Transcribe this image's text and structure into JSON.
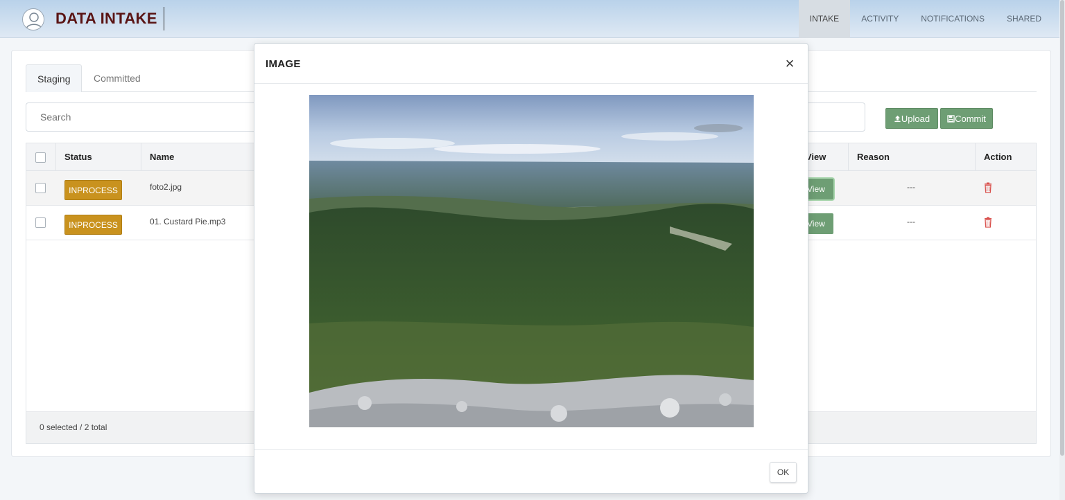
{
  "header": {
    "title": "DATA INTAKE",
    "nav": [
      "INTAKE",
      "ACTIVITY",
      "NOTIFICATIONS",
      "SHARED"
    ],
    "active_nav": "INTAKE"
  },
  "tabs": [
    "Staging",
    "Committed"
  ],
  "search": {
    "placeholder": "Search"
  },
  "toolbar": {
    "upload_label": "Upload",
    "commit_label": "Commit"
  },
  "table": {
    "headers": {
      "status": "Status",
      "name": "Name",
      "view": "View",
      "reason": "Reason",
      "action": "Action"
    },
    "rows": [
      {
        "status": "INPROCESS",
        "name": "foto2.jpg",
        "view": "View",
        "reason": "---"
      },
      {
        "status": "INPROCESS",
        "name": "01. Custard Pie.mp3",
        "view": "View",
        "reason": "---"
      }
    ],
    "footer": "0 selected / 2 total"
  },
  "modal": {
    "title": "IMAGE",
    "close_symbol": "×",
    "ok_label": "OK",
    "image_subject": "mountain-forest-landscape"
  },
  "colors": {
    "accent_green": "#6e9e74",
    "status_badge": "#c9921e",
    "title": "#5a1414",
    "delete_icon": "#d9534f"
  }
}
